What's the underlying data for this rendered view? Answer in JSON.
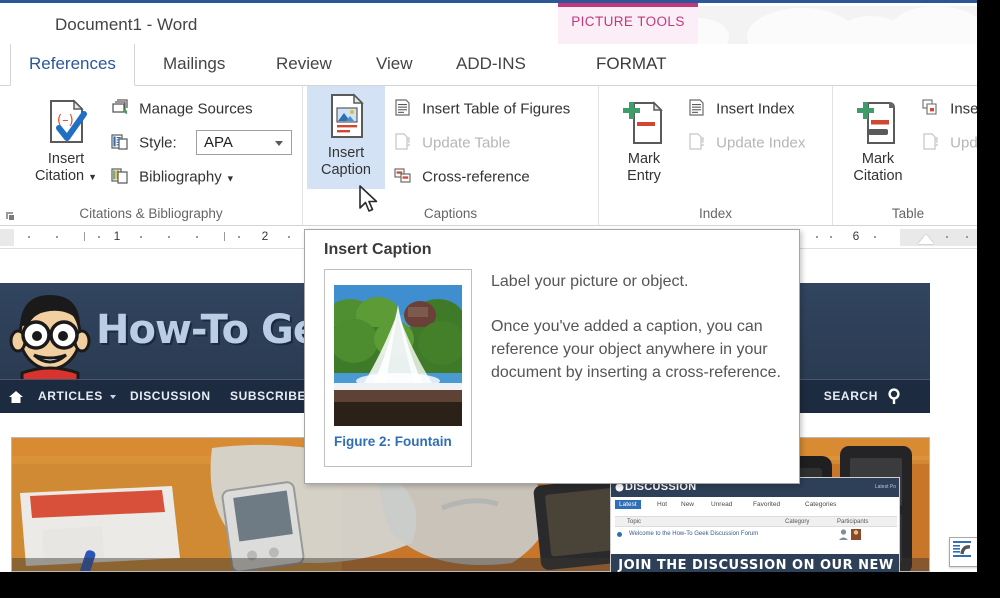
{
  "window": {
    "title": "Document1 - Word"
  },
  "contextual": {
    "group_label": "PICTURE TOOLS",
    "tab_label": "FORMAT",
    "accent_color": "#c2387d",
    "background_color": "#fbeef6"
  },
  "tabs": [
    {
      "label": "References",
      "active": true
    },
    {
      "label": "Mailings",
      "active": false
    },
    {
      "label": "Review",
      "active": false
    },
    {
      "label": "View",
      "active": false
    },
    {
      "label": "ADD-INS",
      "active": false
    }
  ],
  "ribbon": {
    "groups": [
      {
        "name": "Citations & Bibliography",
        "big_button": {
          "line1": "Insert",
          "line2": "Citation",
          "has_dropdown": true,
          "icon": "insert-citation-icon"
        },
        "items": [
          {
            "label": "Manage Sources",
            "icon": "manage-sources-icon",
            "disabled": false
          },
          {
            "label": "Style:",
            "icon": "style-icon",
            "disabled": false
          },
          {
            "label": "Bibliography",
            "icon": "bibliography-icon",
            "disabled": false,
            "has_dropdown": true
          }
        ],
        "combo": {
          "value": "APA"
        }
      },
      {
        "name": "Captions",
        "big_button": {
          "line1": "Insert",
          "line2": "Caption",
          "selected": true,
          "icon": "insert-caption-icon"
        },
        "items": [
          {
            "label": "Insert Table of Figures",
            "icon": "table-of-figures-icon",
            "disabled": false
          },
          {
            "label": "Update Table",
            "icon": "update-table-icon",
            "disabled": true
          },
          {
            "label": "Cross-reference",
            "icon": "cross-reference-icon",
            "disabled": false
          }
        ]
      },
      {
        "name": "Index",
        "big_button": {
          "line1": "Mark",
          "line2": "Entry",
          "icon": "mark-entry-icon"
        },
        "items": [
          {
            "label": "Insert Index",
            "icon": "insert-index-icon",
            "disabled": false
          },
          {
            "label": "Update Index",
            "icon": "update-index-icon",
            "disabled": true
          }
        ]
      },
      {
        "name": "Table ",
        "big_button": {
          "line1": "Mark",
          "line2": "Citation",
          "icon": "mark-citation-icon"
        },
        "items": [
          {
            "label": "Inse",
            "icon": "insert-table-of-authorities-icon",
            "disabled": false
          },
          {
            "label": "Upd",
            "icon": "update-table-of-authorities-icon",
            "disabled": true
          }
        ]
      }
    ]
  },
  "ruler": {
    "numbers": [
      "1",
      "2",
      "6"
    ],
    "unit": "inches"
  },
  "tooltip": {
    "title": "Insert Caption",
    "thumbnail_caption": "Figure 2: Fountain",
    "paragraph1": "Label your picture or object.",
    "paragraph2": "Once you've added a caption, you can reference your object anywhere in your document by inserting a cross-reference."
  },
  "document": {
    "banner": {
      "site_name": "How-To Geek",
      "nav": [
        {
          "label": "ARTICLES",
          "has_caret": true
        },
        {
          "label": "DISCUSSION",
          "has_caret": false
        },
        {
          "label": "SUBSCRIBE",
          "has_caret": true
        }
      ],
      "home_icon": "home-icon",
      "search_label": "SEARCH",
      "search_icon": "search-icon",
      "background_color": "#2e4057"
    },
    "forum_widget": {
      "header_title": "DISCUSSION",
      "header_right": "Latest Po",
      "tabs": [
        "Latest",
        "Hot",
        "New",
        "Unread",
        "Favorited",
        "Categories"
      ],
      "selected_tab": "Latest",
      "columns": [
        "Topic",
        "Category",
        "Participants"
      ],
      "rows": [
        {
          "topic": "Welcome to the How-To Geek Discussion Forum",
          "category": "",
          "participants": "2"
        }
      ],
      "cta": "JOIN THE DISCUSSION ON OUR NEW FORUM"
    },
    "layout_options_icon": "layout-options-icon"
  },
  "cursor": {
    "icon": "mouse-pointer-icon"
  }
}
